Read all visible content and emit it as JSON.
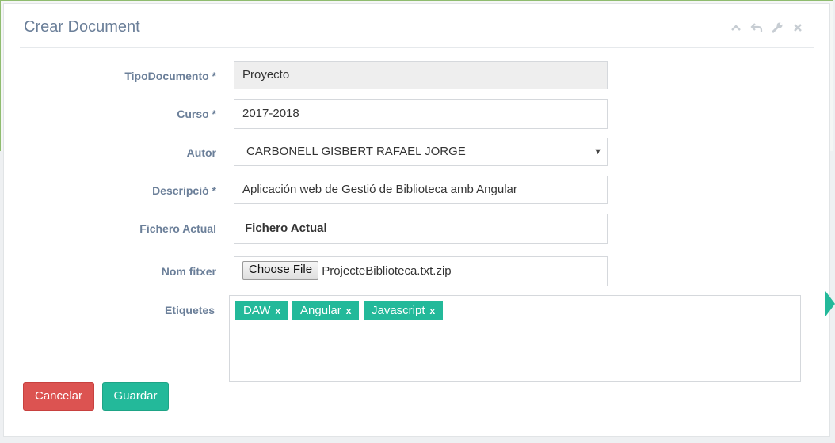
{
  "header": {
    "title": "Crear Document"
  },
  "icons": [
    "chevron-up-icon",
    "reply-icon",
    "wrench-icon",
    "close-icon"
  ],
  "form": {
    "tipo": {
      "label": "TipoDocumento *",
      "value": "Proyecto"
    },
    "curso": {
      "label": "Curso *",
      "value": "2017-2018"
    },
    "autor": {
      "label": "Autor",
      "value": "CARBONELL GISBERT RAFAEL JORGE"
    },
    "descripcio": {
      "label": "Descripció *",
      "value": "Aplicación web de Gestió de Biblioteca amb Angular"
    },
    "fichero": {
      "label": "Fichero Actual",
      "value": "Fichero Actual"
    },
    "nom_fitxer": {
      "label": "Nom fitxer",
      "button": "Choose File",
      "filename": "ProjecteBiblioteca.txt.zip"
    },
    "etiquetes": {
      "label": "Etiquetes",
      "tags": [
        {
          "text": "DAW",
          "remove": "x"
        },
        {
          "text": "Angular",
          "remove": "x"
        },
        {
          "text": "Javascript",
          "remove": "x"
        }
      ]
    }
  },
  "buttons": {
    "cancel": "Cancelar",
    "save": "Guardar"
  },
  "colors": {
    "accent": "#23b99a",
    "danger": "#dc5351",
    "label": "#6b7f99"
  }
}
